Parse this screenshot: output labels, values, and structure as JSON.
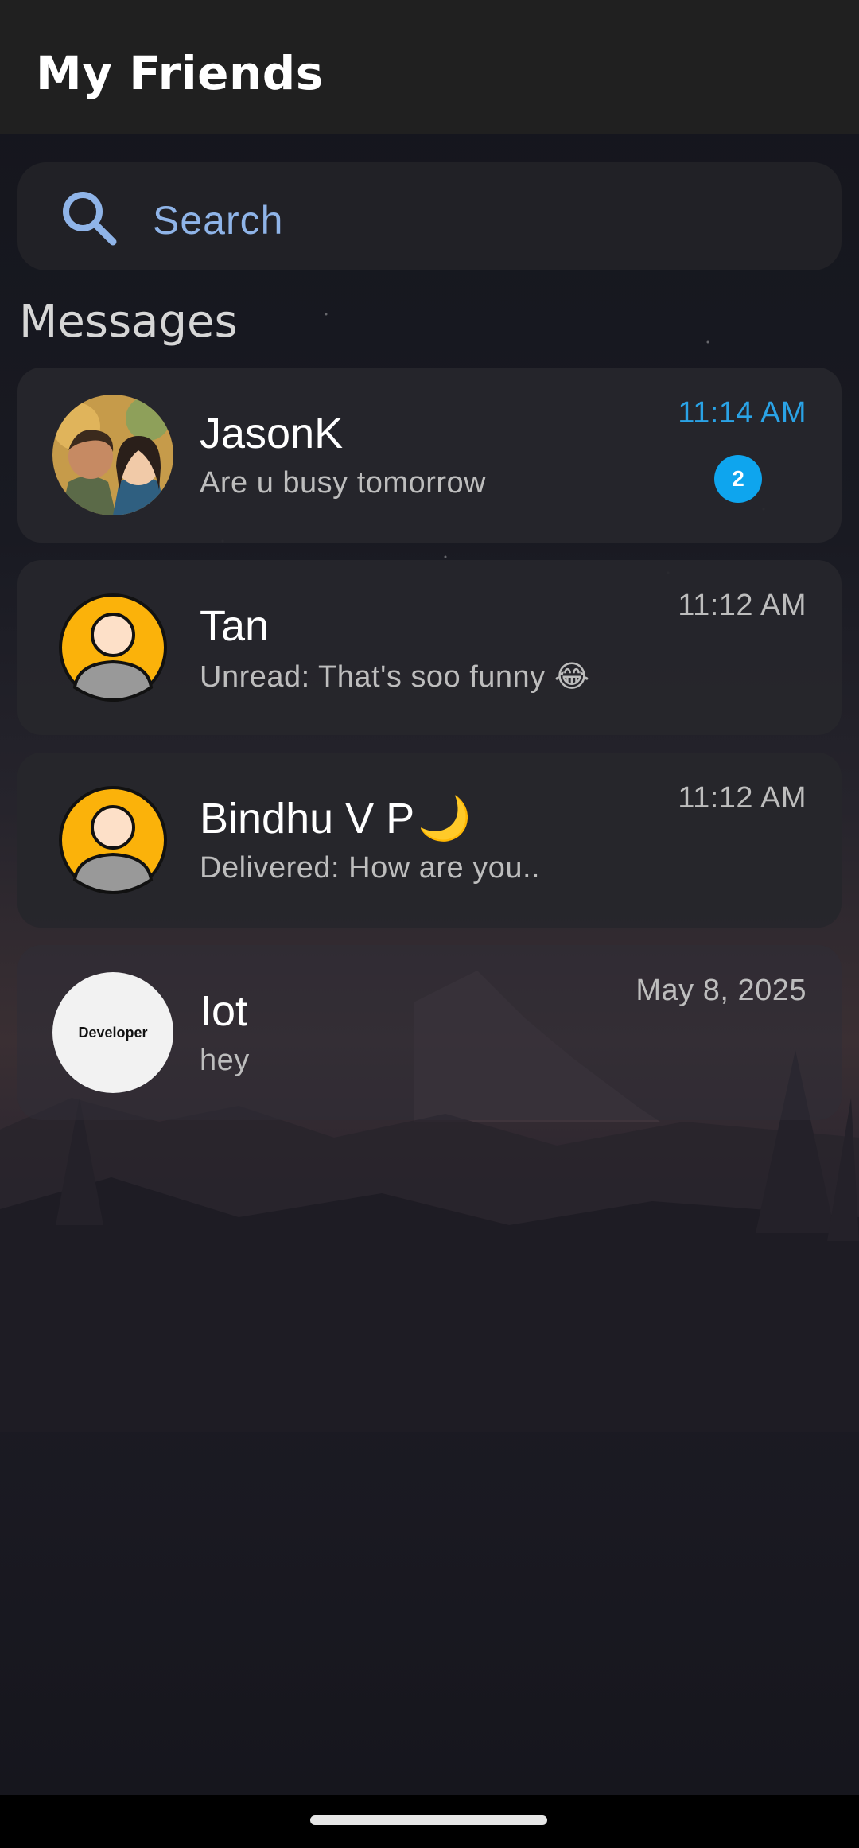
{
  "app": {
    "title": "My Friends"
  },
  "search": {
    "placeholder": "Search",
    "icon": "search-icon"
  },
  "section": {
    "title": "Messages"
  },
  "colors": {
    "accent": "#2aa3e6",
    "badge": "#0ea5ee",
    "card": "#26262c",
    "appbar": "#202020"
  },
  "conversations": [
    {
      "name": "JasonK",
      "preview": "Are u busy tomorrow",
      "time": "11:14 AM",
      "unread": "2",
      "avatar": "couple-photo-avatar",
      "time_accent": true
    },
    {
      "name": "Tan",
      "preview": "Unread: That's soo funny 😂",
      "time": "11:12 AM",
      "avatar": "default-person-avatar"
    },
    {
      "name": "Bindhu V P",
      "name_suffix": "🌙",
      "preview": "Delivered: How are you..",
      "time": "11:12 AM",
      "avatar": "default-person-avatar"
    },
    {
      "name": "Iot",
      "preview": "hey",
      "time": "May 8, 2025",
      "avatar": "developer-logo-avatar",
      "avatar_text": "Developer"
    }
  ]
}
